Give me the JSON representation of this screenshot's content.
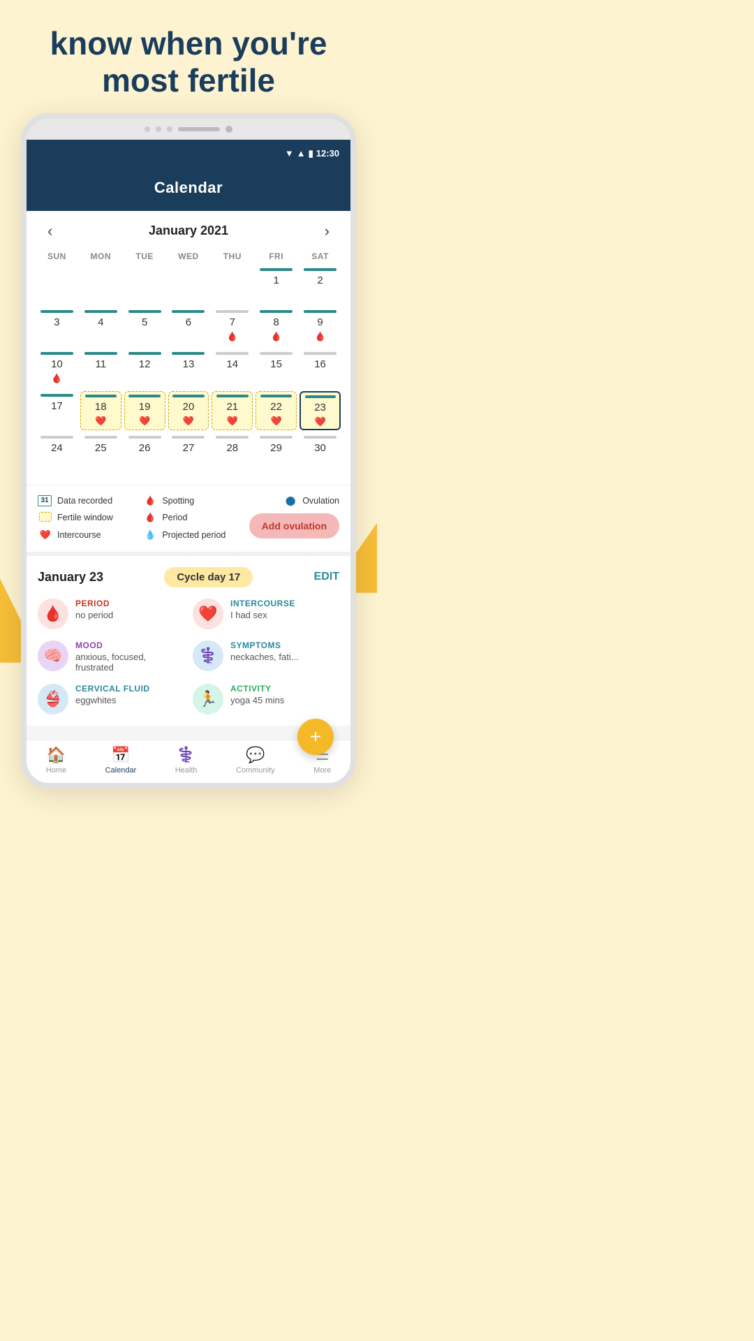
{
  "hero": {
    "title": "know when you're most fertile"
  },
  "status_bar": {
    "time": "12:30"
  },
  "app": {
    "title": "Calendar"
  },
  "calendar": {
    "month_year": "January 2021",
    "weekdays": [
      "SUN",
      "MON",
      "TUE",
      "WED",
      "THU",
      "FRI",
      "SAT"
    ],
    "weeks": [
      [
        {
          "day": "",
          "bar": "none",
          "icons": [],
          "type": "empty"
        },
        {
          "day": "",
          "bar": "none",
          "icons": [],
          "type": "empty"
        },
        {
          "day": "",
          "bar": "none",
          "icons": [],
          "type": "empty"
        },
        {
          "day": "",
          "bar": "none",
          "icons": [],
          "type": "empty"
        },
        {
          "day": "",
          "bar": "none",
          "icons": [],
          "type": "empty"
        },
        {
          "day": "1",
          "bar": "teal",
          "icons": [],
          "type": "normal"
        },
        {
          "day": "2",
          "bar": "teal",
          "icons": [],
          "type": "normal"
        }
      ],
      [
        {
          "day": "3",
          "bar": "teal",
          "icons": [],
          "type": "normal"
        },
        {
          "day": "4",
          "bar": "teal",
          "icons": [],
          "type": "normal"
        },
        {
          "day": "5",
          "bar": "teal",
          "icons": [],
          "type": "normal"
        },
        {
          "day": "6",
          "bar": "teal",
          "icons": [],
          "type": "normal"
        },
        {
          "day": "7",
          "bar": "gray",
          "icons": [
            "🩸"
          ],
          "type": "normal"
        },
        {
          "day": "8",
          "bar": "teal",
          "icons": [
            "🩸"
          ],
          "type": "normal"
        },
        {
          "day": "9",
          "bar": "teal",
          "icons": [
            "🩸"
          ],
          "type": "normal"
        }
      ],
      [
        {
          "day": "10",
          "bar": "teal",
          "icons": [
            "🩸"
          ],
          "type": "normal"
        },
        {
          "day": "11",
          "bar": "teal",
          "icons": [],
          "type": "normal"
        },
        {
          "day": "12",
          "bar": "teal",
          "icons": [],
          "type": "normal"
        },
        {
          "day": "13",
          "bar": "teal",
          "icons": [],
          "type": "normal"
        },
        {
          "day": "14",
          "bar": "gray",
          "icons": [],
          "type": "normal"
        },
        {
          "day": "15",
          "bar": "gray",
          "icons": [],
          "type": "normal"
        },
        {
          "day": "16",
          "bar": "gray",
          "icons": [],
          "type": "normal"
        }
      ],
      [
        {
          "day": "17",
          "bar": "teal",
          "icons": [],
          "type": "normal"
        },
        {
          "day": "18",
          "bar": "teal",
          "icons": [
            "❤️"
          ],
          "type": "fertile"
        },
        {
          "day": "19",
          "bar": "teal",
          "icons": [
            "❤️"
          ],
          "type": "fertile"
        },
        {
          "day": "20",
          "bar": "teal",
          "icons": [
            "❤️"
          ],
          "type": "fertile"
        },
        {
          "day": "21",
          "bar": "teal",
          "icons": [
            "❤️"
          ],
          "type": "fertile"
        },
        {
          "day": "22",
          "bar": "teal",
          "icons": [
            "❤️"
          ],
          "type": "fertile"
        },
        {
          "day": "23",
          "bar": "teal",
          "icons": [
            "❤️"
          ],
          "type": "selected"
        }
      ],
      [
        {
          "day": "24",
          "bar": "gray",
          "icons": [],
          "type": "normal"
        },
        {
          "day": "25",
          "bar": "gray",
          "icons": [],
          "type": "normal"
        },
        {
          "day": "26",
          "bar": "gray",
          "icons": [],
          "type": "normal"
        },
        {
          "day": "27",
          "bar": "gray",
          "icons": [],
          "type": "normal"
        },
        {
          "day": "28",
          "bar": "gray",
          "icons": [],
          "type": "normal"
        },
        {
          "day": "29",
          "bar": "gray",
          "icons": [],
          "type": "normal"
        },
        {
          "day": "30",
          "bar": "gray",
          "icons": [],
          "type": "normal"
        }
      ]
    ]
  },
  "legend": {
    "items": [
      {
        "icon_type": "num",
        "label": "Data recorded"
      },
      {
        "icon_type": "drop_spot",
        "label": "Spotting"
      },
      {
        "icon_type": "dot_blue",
        "label": "Ovulation"
      },
      {
        "icon_type": "fertile_box",
        "label": "Fertile window"
      },
      {
        "icon_type": "drop_red",
        "label": "Period"
      },
      {
        "icon_type": "heart",
        "label": "Intercourse"
      },
      {
        "icon_type": "drop_gray",
        "label": "Projected period"
      }
    ],
    "add_ovulation_label": "Add ovulation"
  },
  "day_detail": {
    "date": "January 23",
    "cycle_day_label": "Cycle day 17",
    "edit_label": "EDIT",
    "items": [
      {
        "category": "PERIOD",
        "value": "no period",
        "icon": "🩸",
        "icon_bg": "pink",
        "label_color": "red"
      },
      {
        "category": "INTERCOURSE",
        "value": "I had sex",
        "icon": "❤️",
        "icon_bg": "pink",
        "label_color": "teal"
      },
      {
        "category": "MOOD",
        "value": "anxious, focused, frustrated",
        "icon": "🧠",
        "icon_bg": "lavender",
        "label_color": "purple"
      },
      {
        "category": "SYMPTOMS",
        "value": "neckaches, fati...",
        "icon": "⚕️",
        "icon_bg": "blue",
        "label_color": "teal"
      },
      {
        "category": "CERVICAL FLUID",
        "value": "eggwhites",
        "icon": "👙",
        "icon_bg": "blue",
        "label_color": "teal"
      },
      {
        "category": "ACTIVITY",
        "value": "yoga 45 mins",
        "icon": "🏃",
        "icon_bg": "green",
        "label_color": "green"
      }
    ]
  },
  "bottom_nav": {
    "items": [
      {
        "label": "Home",
        "icon": "🏠",
        "active": false
      },
      {
        "label": "Calendar",
        "icon": "📅",
        "active": true
      },
      {
        "label": "Health",
        "icon": "⚕️",
        "active": false
      },
      {
        "label": "Community",
        "icon": "💬",
        "active": false
      },
      {
        "label": "More",
        "icon": "☰",
        "active": false
      }
    ]
  },
  "fab": {
    "label": "+"
  }
}
